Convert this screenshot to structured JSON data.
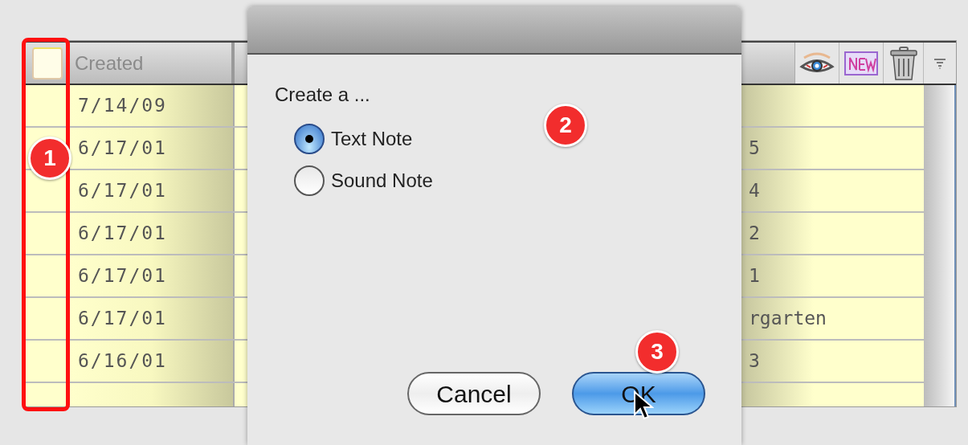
{
  "table": {
    "select_all": {
      "checked": false
    },
    "columns": [
      {
        "label": "Created"
      }
    ],
    "rows": [
      {
        "created": "7/14/09"
      },
      {
        "created": "6/17/01",
        "column_3": "5"
      },
      {
        "created": "6/17/01",
        "column_3": "4"
      },
      {
        "created": "6/17/01",
        "column_3": "2"
      },
      {
        "created": "6/17/01",
        "column_3": "1"
      },
      {
        "created": "6/17/01",
        "column_3": "rgarten"
      },
      {
        "created": "6/16/01",
        "column_3": "3"
      }
    ]
  },
  "dialog": {
    "prompt": "Create a ...",
    "options": [
      {
        "label": "Text Note",
        "selected": true
      },
      {
        "label": "Sound Note",
        "selected": false
      }
    ],
    "buttons": [
      {
        "label": "Cancel",
        "kind": "normal"
      },
      {
        "label": "OK",
        "kind": "default"
      }
    ]
  },
  "callouts": [
    {
      "number": "1"
    },
    {
      "number": "2"
    },
    {
      "number": "3"
    }
  ]
}
